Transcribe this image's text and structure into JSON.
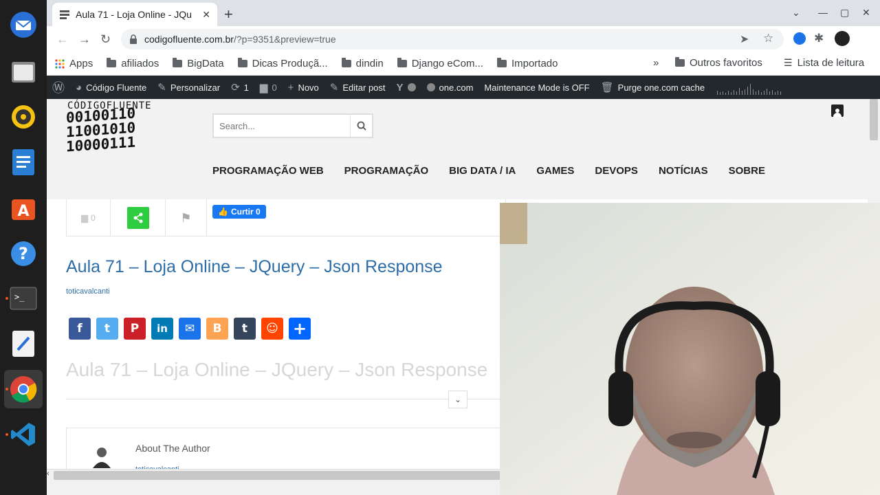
{
  "browser": {
    "tab_title": "Aula 71 - Loja Online - JQu",
    "url_domain": "codigofluente.com.br",
    "url_path": "/?p=9351&preview=true"
  },
  "bookmarks": [
    {
      "label": "Apps"
    },
    {
      "label": "afiliados"
    },
    {
      "label": "BigData"
    },
    {
      "label": "Dicas Produçã..."
    },
    {
      "label": "dindin"
    },
    {
      "label": "Django eCom..."
    },
    {
      "label": "Importado"
    }
  ],
  "bookmarks_more": "»",
  "bookmarks_right": [
    {
      "label": "Outros favoritos"
    },
    {
      "label": "Lista de leitura"
    }
  ],
  "wp_bar": {
    "site": "Código Fluente",
    "customize": "Personalizar",
    "updates": "1",
    "comments": "0",
    "new": "Novo",
    "edit": "Editar post",
    "onecom": "one.com",
    "maintenance": "Maintenance Mode is OFF",
    "purge": "Purge one.com cache"
  },
  "site": {
    "logo_text": "CÓDIGOFLUENTE",
    "logo_bits": [
      "00100110",
      "11001010",
      "10000111"
    ],
    "search_placeholder": "Search...",
    "nav": [
      "PROGRAMAÇÃO WEB",
      "PROGRAMAÇÃO",
      "BIG DATA / IA",
      "GAMES",
      "DEVOPS",
      "NOTÍCIAS",
      "SOBRE"
    ]
  },
  "post": {
    "comment_count": "0",
    "like_label": "Curtir 0",
    "title": "Aula 71 – Loja Online – JQuery – Json Response",
    "author": "toticavalcanti",
    "ghost_title": "Aula 71 – Loja Online – JQuery – Json Response",
    "about_heading": "About The Author",
    "about_name": "toticavalcanti"
  },
  "share_buttons": [
    {
      "name": "facebook",
      "glyph": "f",
      "color": "#3b5998"
    },
    {
      "name": "twitter",
      "glyph": "t",
      "color": "#55acee"
    },
    {
      "name": "pinterest",
      "glyph": "P",
      "color": "#cb2027"
    },
    {
      "name": "linkedin",
      "glyph": "in",
      "color": "#007bb5"
    },
    {
      "name": "email",
      "glyph": "✉",
      "color": "#1a73e8"
    },
    {
      "name": "blogger",
      "glyph": "B",
      "color": "#fda352"
    },
    {
      "name": "tumblr",
      "glyph": "t",
      "color": "#35465c"
    },
    {
      "name": "reddit",
      "glyph": "☺",
      "color": "#ff4500"
    },
    {
      "name": "share-more",
      "glyph": "+",
      "color": "#0166ff"
    }
  ],
  "dock": [
    {
      "name": "thunderbird-icon",
      "color": "#2a6fd6"
    },
    {
      "name": "files-icon",
      "color": "#9a9a9a"
    },
    {
      "name": "rhythmbox-icon",
      "color": "#f5c211"
    },
    {
      "name": "writer-icon",
      "color": "#2a7fd4"
    },
    {
      "name": "software-icon",
      "color": "#e95420"
    },
    {
      "name": "help-icon",
      "color": "#3b8ee6"
    },
    {
      "name": "terminal-icon",
      "color": "#3a3a3a"
    },
    {
      "name": "text-editor-icon",
      "color": "#ececec"
    },
    {
      "name": "chrome-icon",
      "color": "#db4437"
    },
    {
      "name": "vscode-icon",
      "color": "#2489ca"
    }
  ]
}
